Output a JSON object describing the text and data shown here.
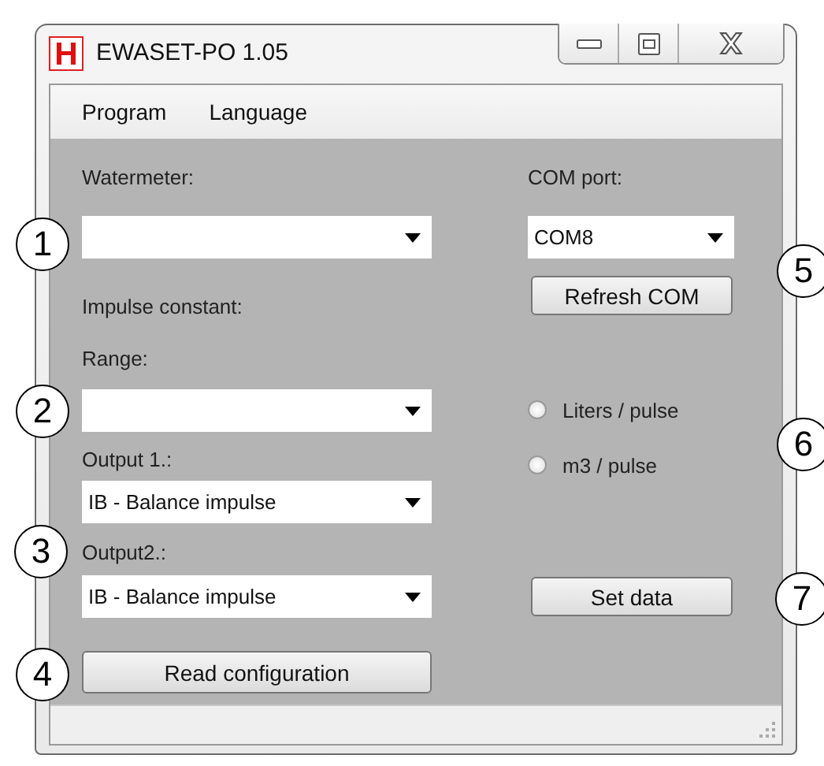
{
  "window": {
    "title": "EWASET-PO 1.05"
  },
  "menu": [
    "Program",
    "Language"
  ],
  "left": [
    {
      "kind": "label",
      "text": "Watermeter:"
    },
    {
      "kind": "combo"
    },
    {
      "kind": "label",
      "text": "Impulse constant:"
    },
    {
      "kind": "label",
      "text": "Range:"
    },
    {
      "kind": "combo"
    },
    {
      "kind": "label",
      "text": "Output 1.:"
    },
    {
      "kind": "combo",
      "value": "IB - Balance impulse"
    },
    {
      "kind": "label",
      "text": "Output2.:"
    },
    {
      "kind": "combo",
      "value": "IB - Balance impulse"
    },
    {
      "kind": "button",
      "text": "Read configuration"
    }
  ],
  "right": [
    {
      "kind": "label",
      "text": "COM port:"
    },
    {
      "kind": "combo",
      "value": "COM8"
    },
    {
      "kind": "button",
      "text": "Refresh COM"
    },
    {
      "kind": "radio",
      "text": "Liters / pulse",
      "selected": false
    },
    {
      "kind": "radio",
      "text": "m3 / pulse",
      "selected": false
    },
    {
      "kind": "button",
      "text": "Set data"
    }
  ],
  "callouts": [
    "1",
    "2",
    "3",
    "4",
    "5",
    "6",
    "7"
  ]
}
